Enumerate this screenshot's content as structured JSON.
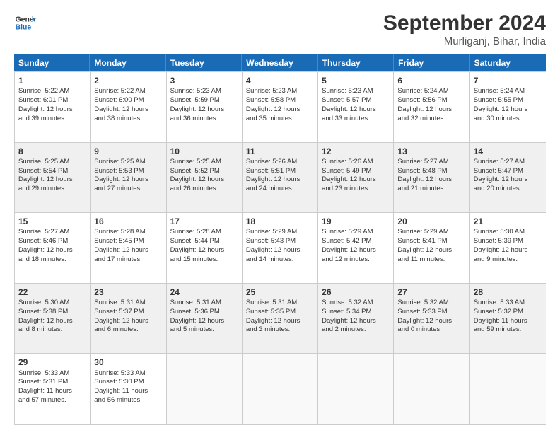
{
  "logo": {
    "line1": "General",
    "line2": "Blue"
  },
  "title": "September 2024",
  "location": "Murliganj, Bihar, India",
  "header_days": [
    "Sunday",
    "Monday",
    "Tuesday",
    "Wednesday",
    "Thursday",
    "Friday",
    "Saturday"
  ],
  "weeks": [
    {
      "shaded": false,
      "days": [
        {
          "num": "1",
          "lines": [
            "Sunrise: 5:22 AM",
            "Sunset: 6:01 PM",
            "Daylight: 12 hours",
            "and 39 minutes."
          ]
        },
        {
          "num": "2",
          "lines": [
            "Sunrise: 5:22 AM",
            "Sunset: 6:00 PM",
            "Daylight: 12 hours",
            "and 38 minutes."
          ]
        },
        {
          "num": "3",
          "lines": [
            "Sunrise: 5:23 AM",
            "Sunset: 5:59 PM",
            "Daylight: 12 hours",
            "and 36 minutes."
          ]
        },
        {
          "num": "4",
          "lines": [
            "Sunrise: 5:23 AM",
            "Sunset: 5:58 PM",
            "Daylight: 12 hours",
            "and 35 minutes."
          ]
        },
        {
          "num": "5",
          "lines": [
            "Sunrise: 5:23 AM",
            "Sunset: 5:57 PM",
            "Daylight: 12 hours",
            "and 33 minutes."
          ]
        },
        {
          "num": "6",
          "lines": [
            "Sunrise: 5:24 AM",
            "Sunset: 5:56 PM",
            "Daylight: 12 hours",
            "and 32 minutes."
          ]
        },
        {
          "num": "7",
          "lines": [
            "Sunrise: 5:24 AM",
            "Sunset: 5:55 PM",
            "Daylight: 12 hours",
            "and 30 minutes."
          ]
        }
      ]
    },
    {
      "shaded": true,
      "days": [
        {
          "num": "8",
          "lines": [
            "Sunrise: 5:25 AM",
            "Sunset: 5:54 PM",
            "Daylight: 12 hours",
            "and 29 minutes."
          ]
        },
        {
          "num": "9",
          "lines": [
            "Sunrise: 5:25 AM",
            "Sunset: 5:53 PM",
            "Daylight: 12 hours",
            "and 27 minutes."
          ]
        },
        {
          "num": "10",
          "lines": [
            "Sunrise: 5:25 AM",
            "Sunset: 5:52 PM",
            "Daylight: 12 hours",
            "and 26 minutes."
          ]
        },
        {
          "num": "11",
          "lines": [
            "Sunrise: 5:26 AM",
            "Sunset: 5:51 PM",
            "Daylight: 12 hours",
            "and 24 minutes."
          ]
        },
        {
          "num": "12",
          "lines": [
            "Sunrise: 5:26 AM",
            "Sunset: 5:49 PM",
            "Daylight: 12 hours",
            "and 23 minutes."
          ]
        },
        {
          "num": "13",
          "lines": [
            "Sunrise: 5:27 AM",
            "Sunset: 5:48 PM",
            "Daylight: 12 hours",
            "and 21 minutes."
          ]
        },
        {
          "num": "14",
          "lines": [
            "Sunrise: 5:27 AM",
            "Sunset: 5:47 PM",
            "Daylight: 12 hours",
            "and 20 minutes."
          ]
        }
      ]
    },
    {
      "shaded": false,
      "days": [
        {
          "num": "15",
          "lines": [
            "Sunrise: 5:27 AM",
            "Sunset: 5:46 PM",
            "Daylight: 12 hours",
            "and 18 minutes."
          ]
        },
        {
          "num": "16",
          "lines": [
            "Sunrise: 5:28 AM",
            "Sunset: 5:45 PM",
            "Daylight: 12 hours",
            "and 17 minutes."
          ]
        },
        {
          "num": "17",
          "lines": [
            "Sunrise: 5:28 AM",
            "Sunset: 5:44 PM",
            "Daylight: 12 hours",
            "and 15 minutes."
          ]
        },
        {
          "num": "18",
          "lines": [
            "Sunrise: 5:29 AM",
            "Sunset: 5:43 PM",
            "Daylight: 12 hours",
            "and 14 minutes."
          ]
        },
        {
          "num": "19",
          "lines": [
            "Sunrise: 5:29 AM",
            "Sunset: 5:42 PM",
            "Daylight: 12 hours",
            "and 12 minutes."
          ]
        },
        {
          "num": "20",
          "lines": [
            "Sunrise: 5:29 AM",
            "Sunset: 5:41 PM",
            "Daylight: 12 hours",
            "and 11 minutes."
          ]
        },
        {
          "num": "21",
          "lines": [
            "Sunrise: 5:30 AM",
            "Sunset: 5:39 PM",
            "Daylight: 12 hours",
            "and 9 minutes."
          ]
        }
      ]
    },
    {
      "shaded": true,
      "days": [
        {
          "num": "22",
          "lines": [
            "Sunrise: 5:30 AM",
            "Sunset: 5:38 PM",
            "Daylight: 12 hours",
            "and 8 minutes."
          ]
        },
        {
          "num": "23",
          "lines": [
            "Sunrise: 5:31 AM",
            "Sunset: 5:37 PM",
            "Daylight: 12 hours",
            "and 6 minutes."
          ]
        },
        {
          "num": "24",
          "lines": [
            "Sunrise: 5:31 AM",
            "Sunset: 5:36 PM",
            "Daylight: 12 hours",
            "and 5 minutes."
          ]
        },
        {
          "num": "25",
          "lines": [
            "Sunrise: 5:31 AM",
            "Sunset: 5:35 PM",
            "Daylight: 12 hours",
            "and 3 minutes."
          ]
        },
        {
          "num": "26",
          "lines": [
            "Sunrise: 5:32 AM",
            "Sunset: 5:34 PM",
            "Daylight: 12 hours",
            "and 2 minutes."
          ]
        },
        {
          "num": "27",
          "lines": [
            "Sunrise: 5:32 AM",
            "Sunset: 5:33 PM",
            "Daylight: 12 hours",
            "and 0 minutes."
          ]
        },
        {
          "num": "28",
          "lines": [
            "Sunrise: 5:33 AM",
            "Sunset: 5:32 PM",
            "Daylight: 11 hours",
            "and 59 minutes."
          ]
        }
      ]
    },
    {
      "shaded": false,
      "days": [
        {
          "num": "29",
          "lines": [
            "Sunrise: 5:33 AM",
            "Sunset: 5:31 PM",
            "Daylight: 11 hours",
            "and 57 minutes."
          ]
        },
        {
          "num": "30",
          "lines": [
            "Sunrise: 5:33 AM",
            "Sunset: 5:30 PM",
            "Daylight: 11 hours",
            "and 56 minutes."
          ]
        },
        null,
        null,
        null,
        null,
        null
      ]
    }
  ]
}
